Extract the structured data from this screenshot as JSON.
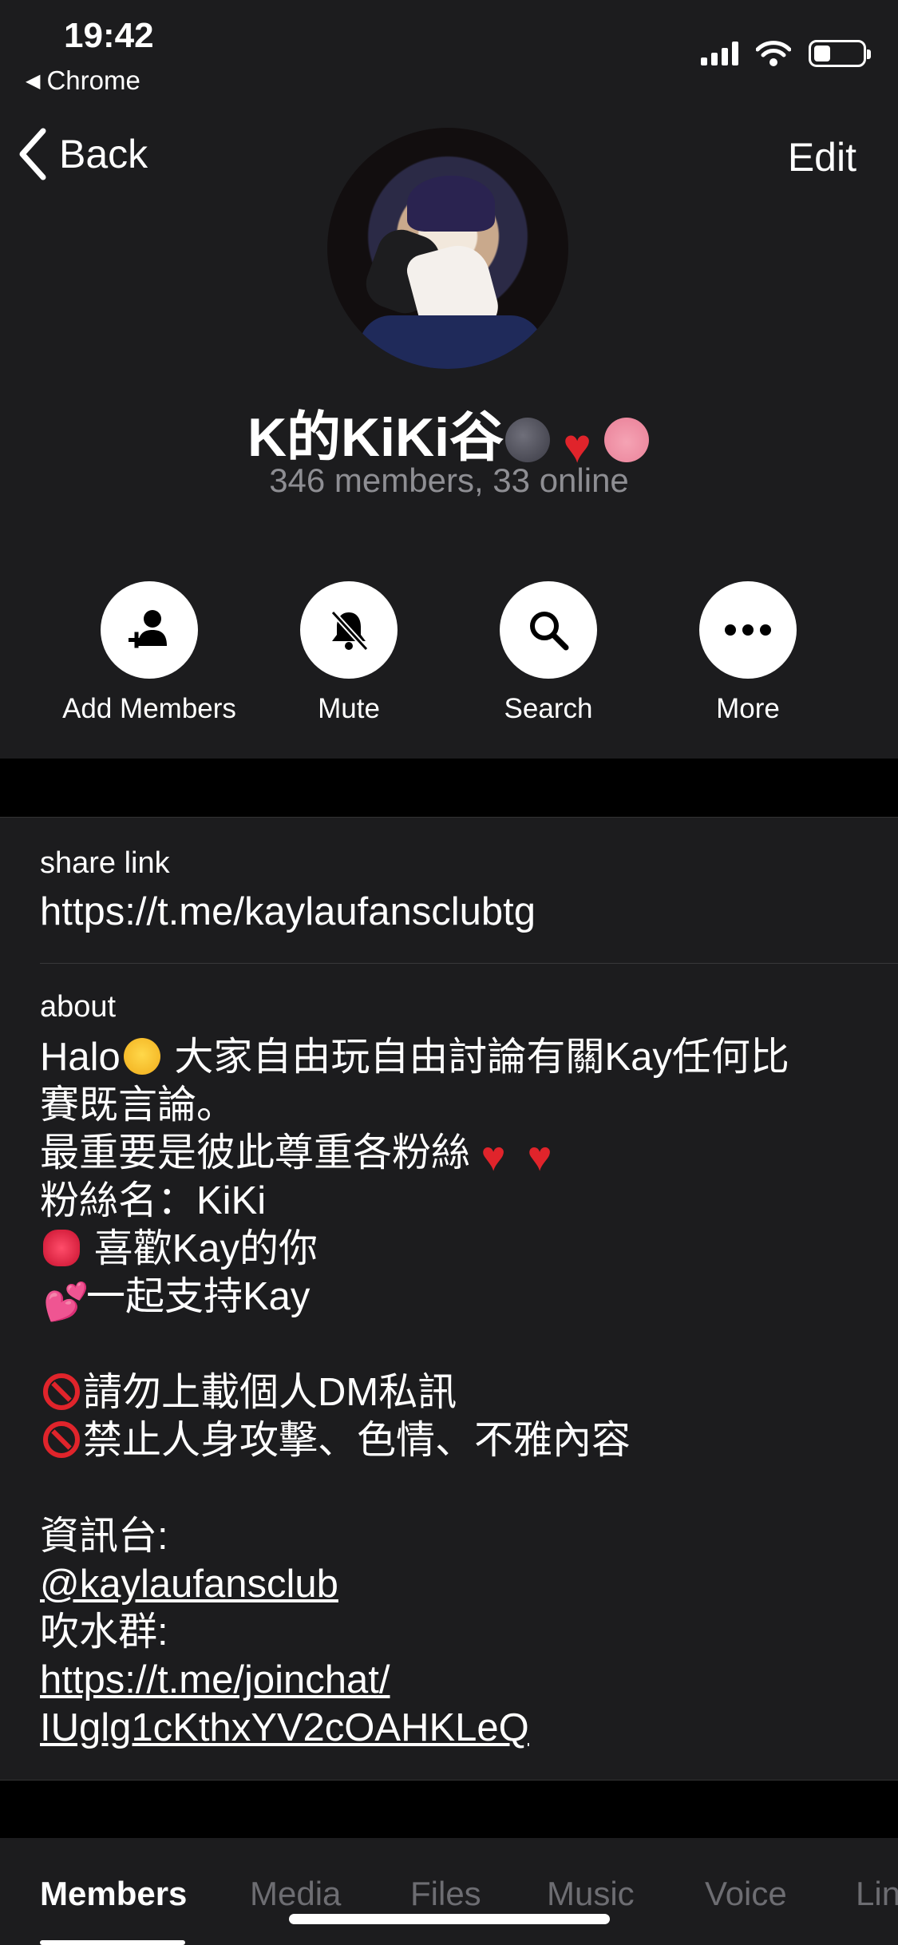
{
  "status_bar": {
    "time": "19:42",
    "back_app": "Chrome"
  },
  "nav": {
    "back_label": "Back",
    "edit_label": "Edit"
  },
  "group": {
    "name": "K的KiKi谷",
    "members_info": "346 members, 33 online"
  },
  "actions": [
    {
      "label": "Add Members",
      "icon": "add-member-icon"
    },
    {
      "label": "Mute",
      "icon": "bell-slash-icon"
    },
    {
      "label": "Search",
      "icon": "search-icon"
    },
    {
      "label": "More",
      "icon": "ellipsis-icon"
    }
  ],
  "share_link": {
    "label": "share link",
    "value": "https://t.me/kaylaufansclubtg"
  },
  "about": {
    "label": "about",
    "line1": "Halo",
    "line1b": " 大家自由玩自由討論有關Kay任何比",
    "line2": "賽既言論。",
    "line3": "最重要是彼此尊重各粉絲",
    "line4": "粉絲名：KiKi",
    "line5": " 喜歡Kay的你",
    "line6": "一起支持Kay",
    "line7": "請勿上載個人DM私訊",
    "line8": "禁止人身攻擊、色情、不雅內容",
    "line9": "資訊台:",
    "link1": "@kaylaufansclub",
    "line10": "吹水群:",
    "link2a": "https://t.me/joinchat/",
    "link2b": "IUglg1cKthxYV2cOAHKLeQ"
  },
  "tabs": [
    "Members",
    "Media",
    "Files",
    "Music",
    "Voice",
    "Lin"
  ],
  "colors": {
    "background": "#000000",
    "panel": "#1c1c1e",
    "secondary_text": "#8e8e93"
  }
}
